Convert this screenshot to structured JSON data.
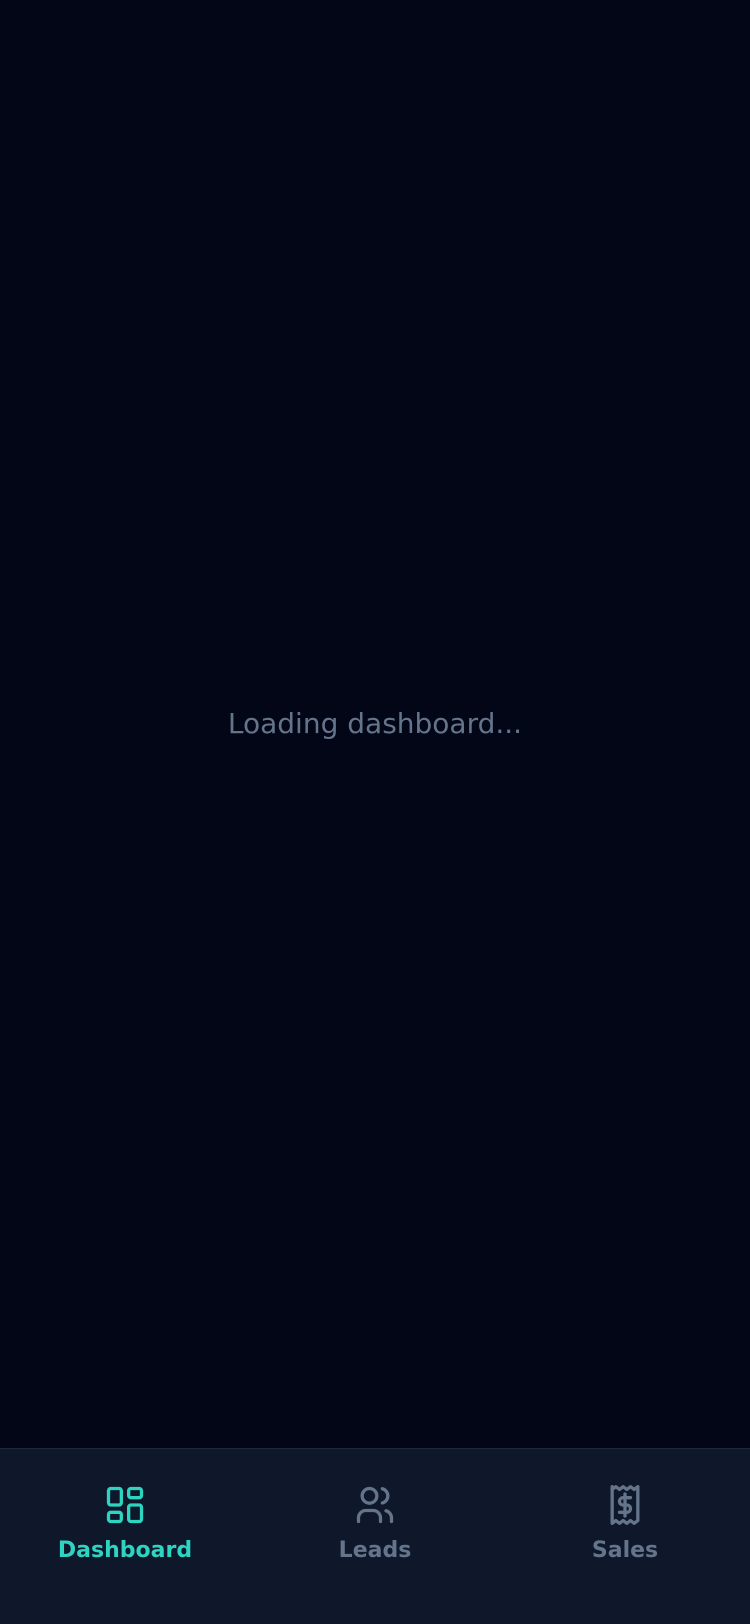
{
  "main": {
    "loading_text": "Loading dashboard..."
  },
  "tabbar": {
    "items": [
      {
        "label": "Dashboard",
        "icon": "dashboard-grid-icon",
        "active": true
      },
      {
        "label": "Leads",
        "icon": "users-icon",
        "active": false
      },
      {
        "label": "Sales",
        "icon": "receipt-dollar-icon",
        "active": false
      }
    ]
  },
  "colors": {
    "background": "#020617",
    "tabbar_background": "#0f172a",
    "accent": "#2dd4bf",
    "muted": "#64748b"
  }
}
